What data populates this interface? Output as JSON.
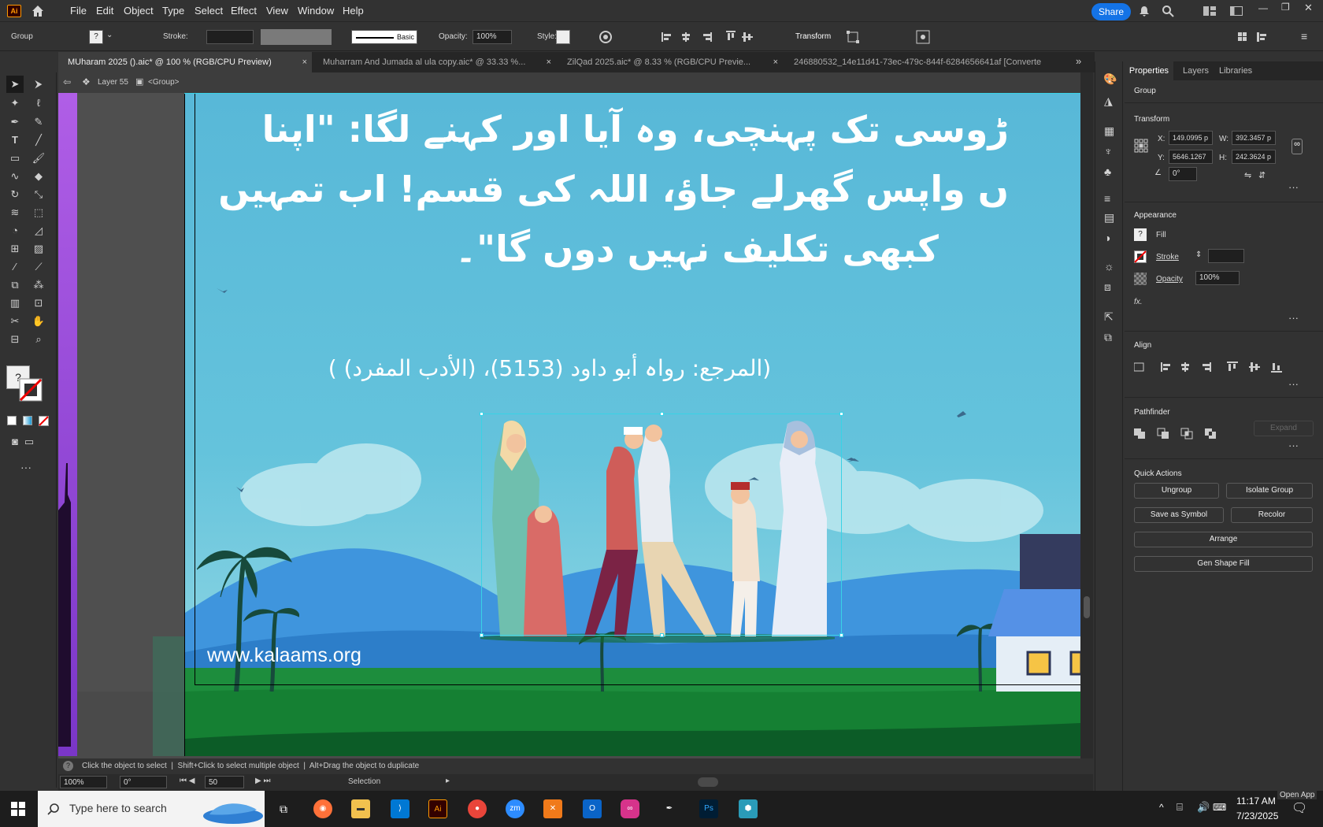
{
  "menubar": {
    "app_icon": "Ai",
    "items": [
      "File",
      "Edit",
      "Object",
      "Type",
      "Select",
      "Effect",
      "View",
      "Window",
      "Help"
    ],
    "share": "Share"
  },
  "control": {
    "selection_type": "Group",
    "stroke_label": "Stroke:",
    "brush": "Basic",
    "opacity_label": "Opacity:",
    "opacity": "100%",
    "style_label": "Style:",
    "transform": "Transform",
    "fill_unknown": "?"
  },
  "tabs": [
    {
      "label": "MUharam 2025 ().aic* @ 100 % (RGB/CPU Preview)",
      "close": "×"
    },
    {
      "label": "Muharram And Jumada al ula copy.aic* @ 33.33 %...",
      "close": "×"
    },
    {
      "label": "ZilQad 2025.aic* @ 8.33 % (RGB/CPU Previe...",
      "close": "×"
    },
    {
      "label": "246880532_14e11d41-73ec-479c-844f-6284656641af [Converte",
      "close": ""
    }
  ],
  "breadcrumb": {
    "layer": "Layer 55",
    "group": "<Group>"
  },
  "artwork": {
    "urdu_line1": "ڑوسی تک پہنچی، وہ آیا اور کہنے لگا: \"اپنا",
    "urdu_line2": "ں واپس گھرلے جاؤ، اللہ کی قسم! اب تمہیں",
    "urdu_line3": "کبھی تکلیف نہیں دوں گا\"۔",
    "reference": "(المرجع: رواہ أبو داود (5153)، (الأدب المفرد) )",
    "website": "www.kalaams.org"
  },
  "status": {
    "hint": "Click the object to select  |  Shift+Click to select multiple object  |  Alt+Drag the object to duplicate",
    "zoom": "100%",
    "rotation": "0°",
    "artboard": "50",
    "tool": "Selection"
  },
  "panel": {
    "tabs": [
      "Properties",
      "Layers",
      "Libraries"
    ],
    "group": "Group",
    "transform": {
      "title": "Transform",
      "x_label": "X:",
      "x": "149.0995 p",
      "y_label": "Y:",
      "y": "5646.1267",
      "w_label": "W:",
      "w": "392.3457 p",
      "h_label": "H:",
      "h": "242.3624 p",
      "angle": "0°"
    },
    "appearance": {
      "title": "Appearance",
      "fill": "Fill",
      "stroke": "Stroke",
      "opacity": "Opacity",
      "opacity_value": "100%",
      "fx": "fx."
    },
    "align": "Align",
    "pathfinder": {
      "title": "Pathfinder",
      "expand": "Expand"
    },
    "quick_actions": {
      "title": "Quick Actions",
      "ungroup": "Ungroup",
      "isolate": "Isolate Group",
      "save_symbol": "Save as Symbol",
      "recolor": "Recolor",
      "arrange": "Arrange",
      "gen_shape": "Gen Shape Fill"
    }
  },
  "taskbar": {
    "search": "Type here to search",
    "time": "11:17 AM",
    "date": "7/23/2025",
    "open_app": "Open App"
  },
  "colors": {
    "sky": "#5bbad6",
    "grass": "#1c8a3a",
    "accent": "#1473e6"
  }
}
